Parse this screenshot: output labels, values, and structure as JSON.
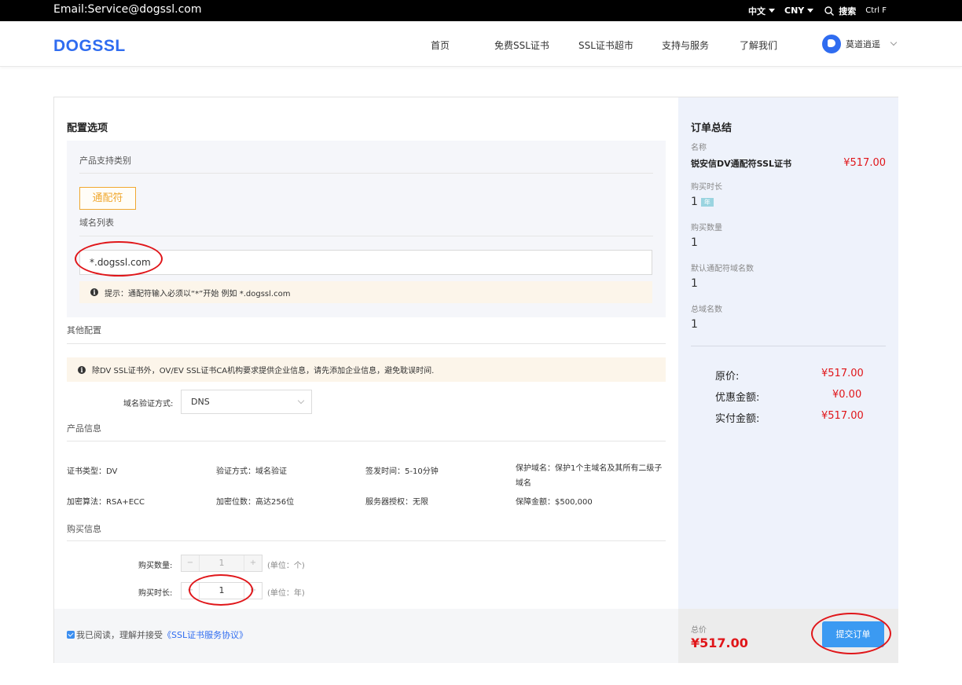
{
  "topbar": {
    "email": "Email:Service@dogssl.com",
    "lang": "中文",
    "currency": "CNY",
    "search_label": "搜索",
    "shortcut": "Ctrl F"
  },
  "header": {
    "logo_text": "DOGSSL",
    "nav": [
      "首页",
      "免费SSL证书",
      "SSL证书超市",
      "支持与服务",
      "了解我们"
    ],
    "user_name": "莫道逍遥"
  },
  "config": {
    "title": "配置选项",
    "product_type_label": "产品支持类别",
    "wildcard_button": "通配符",
    "domain_list_label": "域名列表",
    "domain_value": "*.dogssl.com",
    "domain_tip": "提示：通配符输入必须以“*”开始 例如 *.dogssl.com",
    "other_config_label": "其他配置",
    "other_tip": "除DV SSL证书外，OV/EV SSL证书CA机构要求提供企业信息，请先添加企业信息，避免耽误时间.",
    "verify_method_label": "域名验证方式:",
    "verify_method_value": "DNS",
    "product_info_label": "产品信息",
    "product_info": [
      "证书类型：DV",
      "验证方式：域名验证",
      "签发时间：5-10分钟",
      "保护域名：保护1个主域名及其所有二级子域名",
      "加密算法：RSA+ECC",
      "加密位数：高达256位",
      "服务器授权：无限",
      "保障金额：$500,000"
    ],
    "purchase_info_label": "购买信息",
    "quantity_label": "购买数量:",
    "quantity_value": "1",
    "quantity_unit": "(单位：个)",
    "duration_label": "购买时长:",
    "duration_value": "1",
    "duration_unit": "(单位：年)",
    "stepper_minus": "−",
    "stepper_plus": "+",
    "agree_text": "我已阅读，理解并接受",
    "agree_link": "《SSL证书服务协议》"
  },
  "summary": {
    "title": "订单总结",
    "name_label": "名称",
    "product_name": "锐安信DV通配符SSL证书",
    "product_price": "¥517.00",
    "duration_label": "购买时长",
    "duration_value": "1",
    "duration_tag": "年",
    "quantity_label": "购买数量",
    "quantity_value": "1",
    "default_wildcard_label": "默认通配符域名数",
    "default_wildcard_value": "1",
    "total_domains_label": "总域名数",
    "total_domains_value": "1",
    "original_label": "原价:",
    "original_value": "¥517.00",
    "discount_label": "优惠金额:",
    "discount_value": "¥0.00",
    "paid_label": "实付金额:",
    "paid_value": "¥517.00",
    "total_label": "总价",
    "total_value": "¥517.00",
    "submit_label": "提交订单"
  },
  "colors": {
    "brand": "#2f6cf0",
    "price": "#e0161a",
    "accent": "#f0a830",
    "submit": "#3b9af2",
    "annotation": "#e0161a"
  }
}
